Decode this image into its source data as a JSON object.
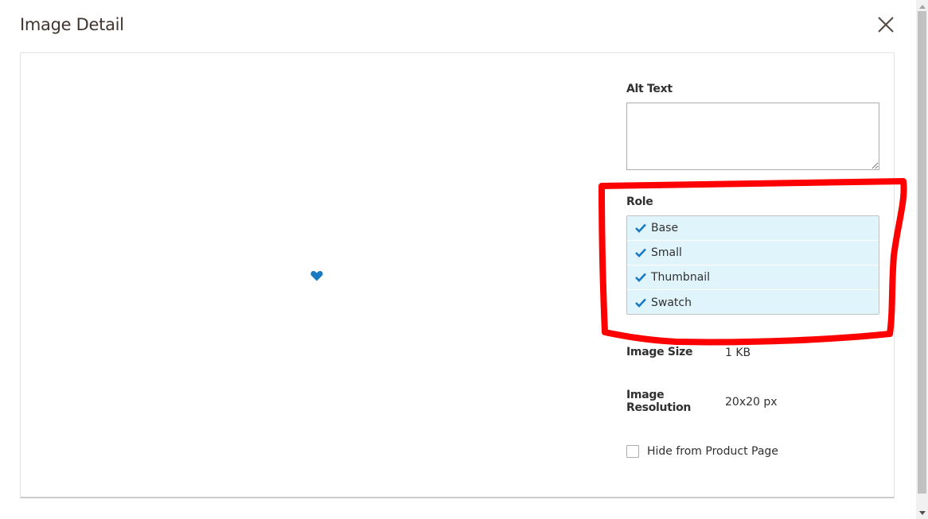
{
  "modal": {
    "title": "Image Detail",
    "close_icon": "close-icon"
  },
  "preview": {
    "icon": "heart-icon",
    "icon_color": "#1979c3"
  },
  "alt_text": {
    "label": "Alt Text",
    "value": "",
    "placeholder": ""
  },
  "role": {
    "label": "Role",
    "selected_bg": "#e0f4fb",
    "check_color": "#1979c3",
    "items": [
      {
        "label": "Base",
        "selected": true
      },
      {
        "label": "Small",
        "selected": true
      },
      {
        "label": "Thumbnail",
        "selected": true
      },
      {
        "label": "Swatch",
        "selected": true
      }
    ]
  },
  "info": {
    "image_size_label": "Image Size",
    "image_size_value": "1 KB",
    "image_resolution_label_line1": "Image",
    "image_resolution_label_line2": "Resolution",
    "image_resolution_value": "20x20 px"
  },
  "hide_from_product_page": {
    "label": "Hide from Product Page",
    "checked": false
  },
  "annotation": {
    "color": "#ff0000",
    "description": "red hand-drawn outline around Role section"
  }
}
